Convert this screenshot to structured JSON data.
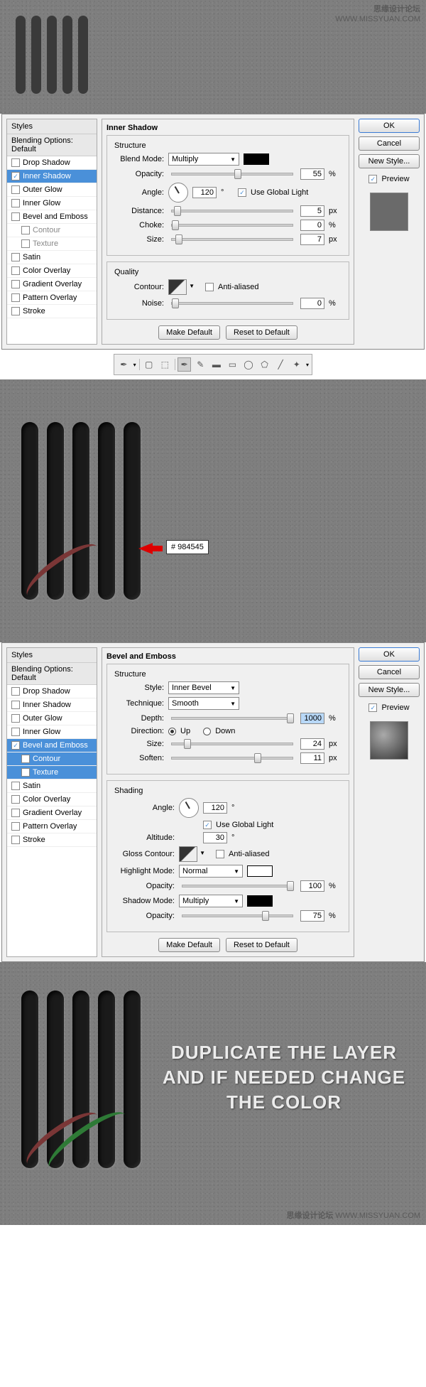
{
  "watermark": {
    "title": "思缘设计论坛",
    "url": "WWW.MISSYUAN.COM"
  },
  "styles_panel": {
    "header": "Styles",
    "blending": "Blending Options: Default",
    "drop_shadow": "Drop Shadow",
    "inner_shadow": "Inner Shadow",
    "outer_glow": "Outer Glow",
    "inner_glow": "Inner Glow",
    "bevel": "Bevel and Emboss",
    "contour": "Contour",
    "texture": "Texture",
    "satin": "Satin",
    "color_overlay": "Color Overlay",
    "gradient_overlay": "Gradient Overlay",
    "pattern_overlay": "Pattern Overlay",
    "stroke": "Stroke"
  },
  "buttons": {
    "ok": "OK",
    "cancel": "Cancel",
    "new_style": "New Style...",
    "preview": "Preview",
    "make_default": "Make Default",
    "reset_default": "Reset to Default"
  },
  "inner_shadow": {
    "title": "Inner Shadow",
    "structure": "Structure",
    "blend_mode_label": "Blend Mode:",
    "blend_mode": "Multiply",
    "opacity_label": "Opacity:",
    "opacity": "55",
    "angle_label": "Angle:",
    "angle": "120",
    "angle_unit": "°",
    "global_light": "Use Global Light",
    "distance_label": "Distance:",
    "distance": "5",
    "choke_label": "Choke:",
    "choke": "0",
    "size_label": "Size:",
    "size": "7",
    "quality": "Quality",
    "contour_label": "Contour:",
    "anti_aliased": "Anti-aliased",
    "noise_label": "Noise:",
    "noise": "0",
    "pct": "%",
    "px": "px"
  },
  "hex_color": "# 984545",
  "bevel": {
    "title": "Bevel and Emboss",
    "structure": "Structure",
    "style_label": "Style:",
    "style": "Inner Bevel",
    "technique_label": "Technique:",
    "technique": "Smooth",
    "depth_label": "Depth:",
    "depth": "1000",
    "direction_label": "Direction:",
    "up": "Up",
    "down": "Down",
    "size_label": "Size:",
    "size": "24",
    "soften_label": "Soften:",
    "soften": "11",
    "shading": "Shading",
    "angle_label": "Angle:",
    "angle": "120",
    "global_light": "Use Global Light",
    "altitude_label": "Altitude:",
    "altitude": "30",
    "gloss_label": "Gloss Contour:",
    "anti_aliased": "Anti-aliased",
    "highlight_label": "Highlight Mode:",
    "highlight": "Normal",
    "opacity_label": "Opacity:",
    "hl_opacity": "100",
    "shadow_label": "Shadow Mode:",
    "shadow": "Multiply",
    "sh_opacity": "75",
    "pct": "%",
    "px": "px",
    "deg": "°"
  },
  "final_text": "DUPLICATE THE LAYER AND IF NEEDED CHANGE THE COLOR"
}
